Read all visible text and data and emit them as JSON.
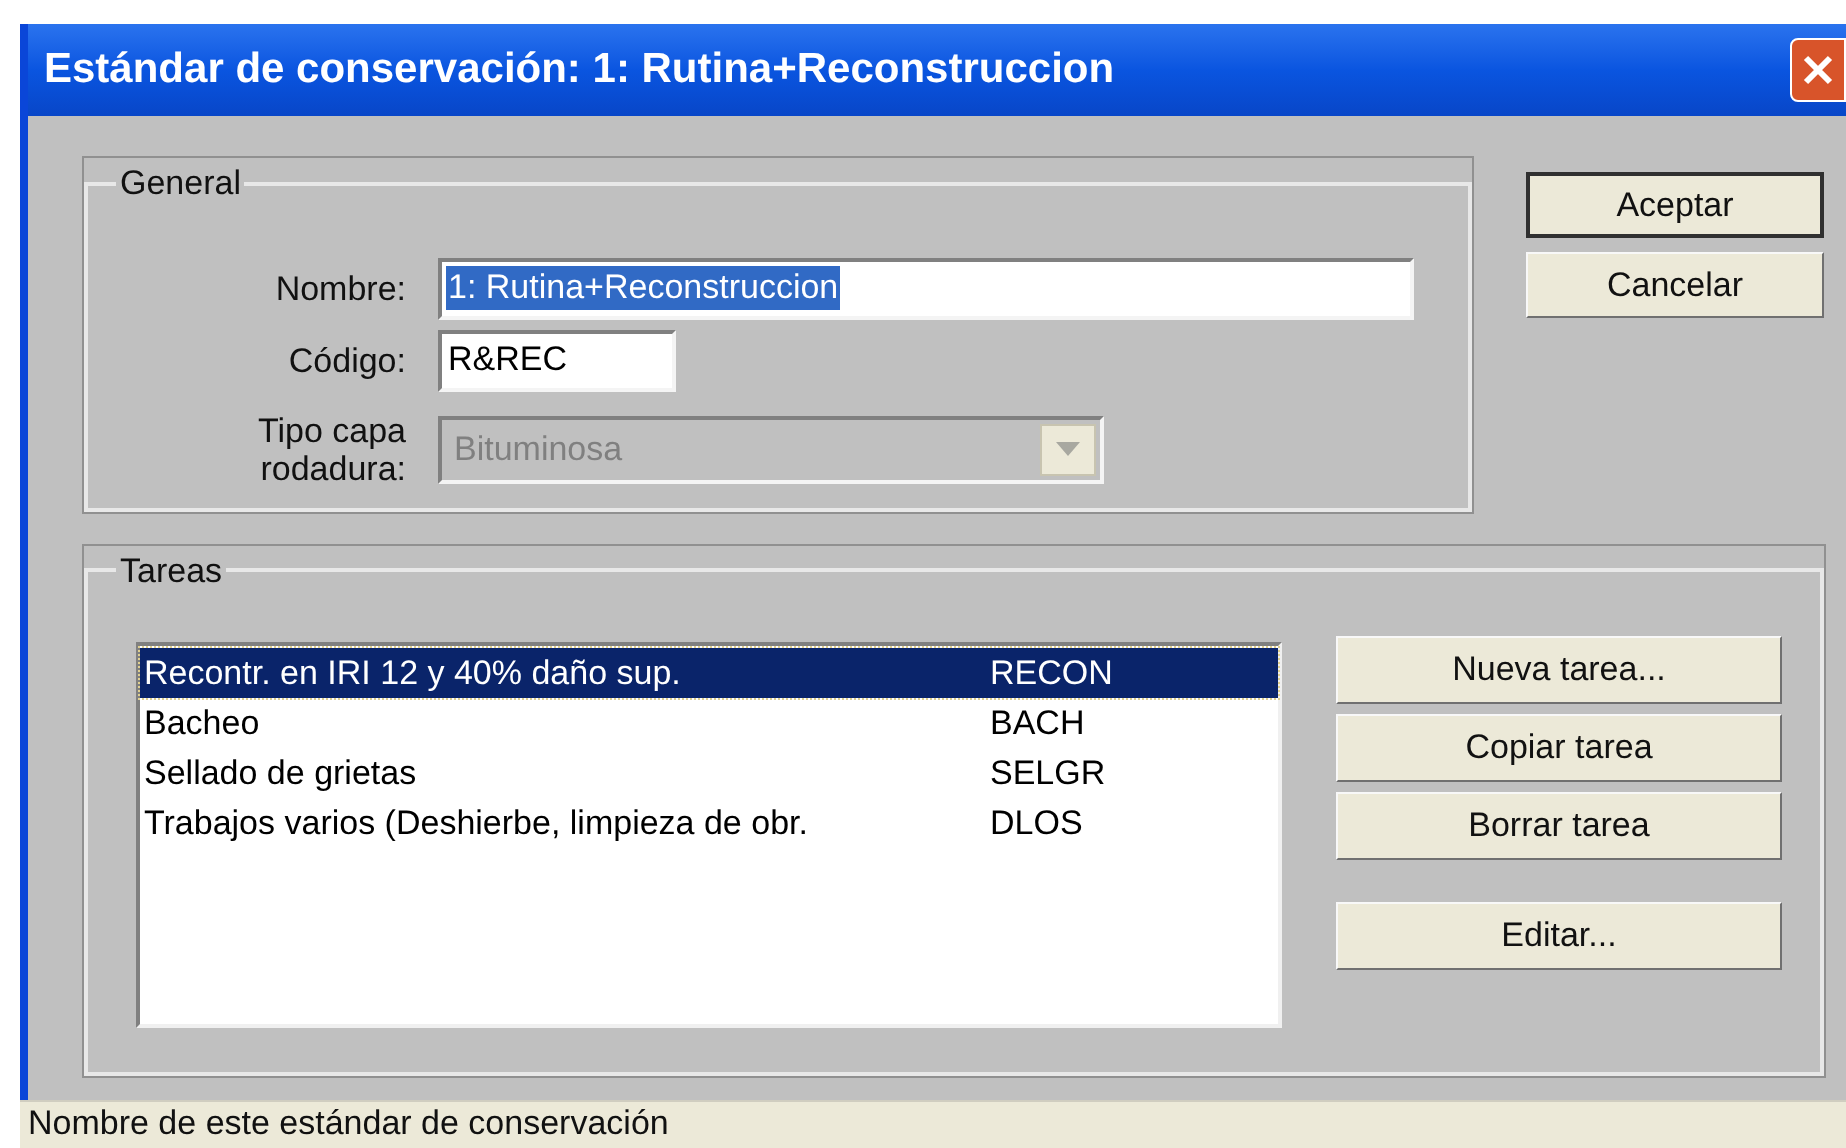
{
  "window": {
    "title": "Estándar de conservación: 1: Rutina+Reconstruccion"
  },
  "general": {
    "legend": "General",
    "fields": [
      {
        "label": "Nombre:",
        "value": "1: Rutina+Reconstruccion",
        "kind": "text",
        "highlighted": true,
        "disabled": false
      },
      {
        "label": "Código:",
        "value": "R&REC",
        "kind": "text",
        "highlighted": false,
        "disabled": false
      },
      {
        "label": "Tipo capa rodadura:",
        "value": "Bituminosa",
        "kind": "dropdown",
        "disabled": true
      }
    ]
  },
  "dialog_buttons": [
    {
      "label": "Aceptar",
      "default": true
    },
    {
      "label": "Cancelar",
      "default": false
    }
  ],
  "tasks": {
    "legend": "Tareas",
    "rows": [
      {
        "name": "Recontr. en IRI 12 y 40% daño sup.",
        "code": "RECON",
        "selected": true
      },
      {
        "name": "Bacheo",
        "code": "BACH",
        "selected": false
      },
      {
        "name": "Sellado de grietas",
        "code": "SELGR",
        "selected": false
      },
      {
        "name": "Trabajos varios (Deshierbe, limpieza de obr.",
        "code": "DLOS",
        "selected": false
      }
    ],
    "buttons": [
      "Nueva tarea...",
      "Copiar tarea",
      "Borrar tarea",
      "Editar..."
    ]
  },
  "status_bar": "Nombre de este estándar de conservación"
}
